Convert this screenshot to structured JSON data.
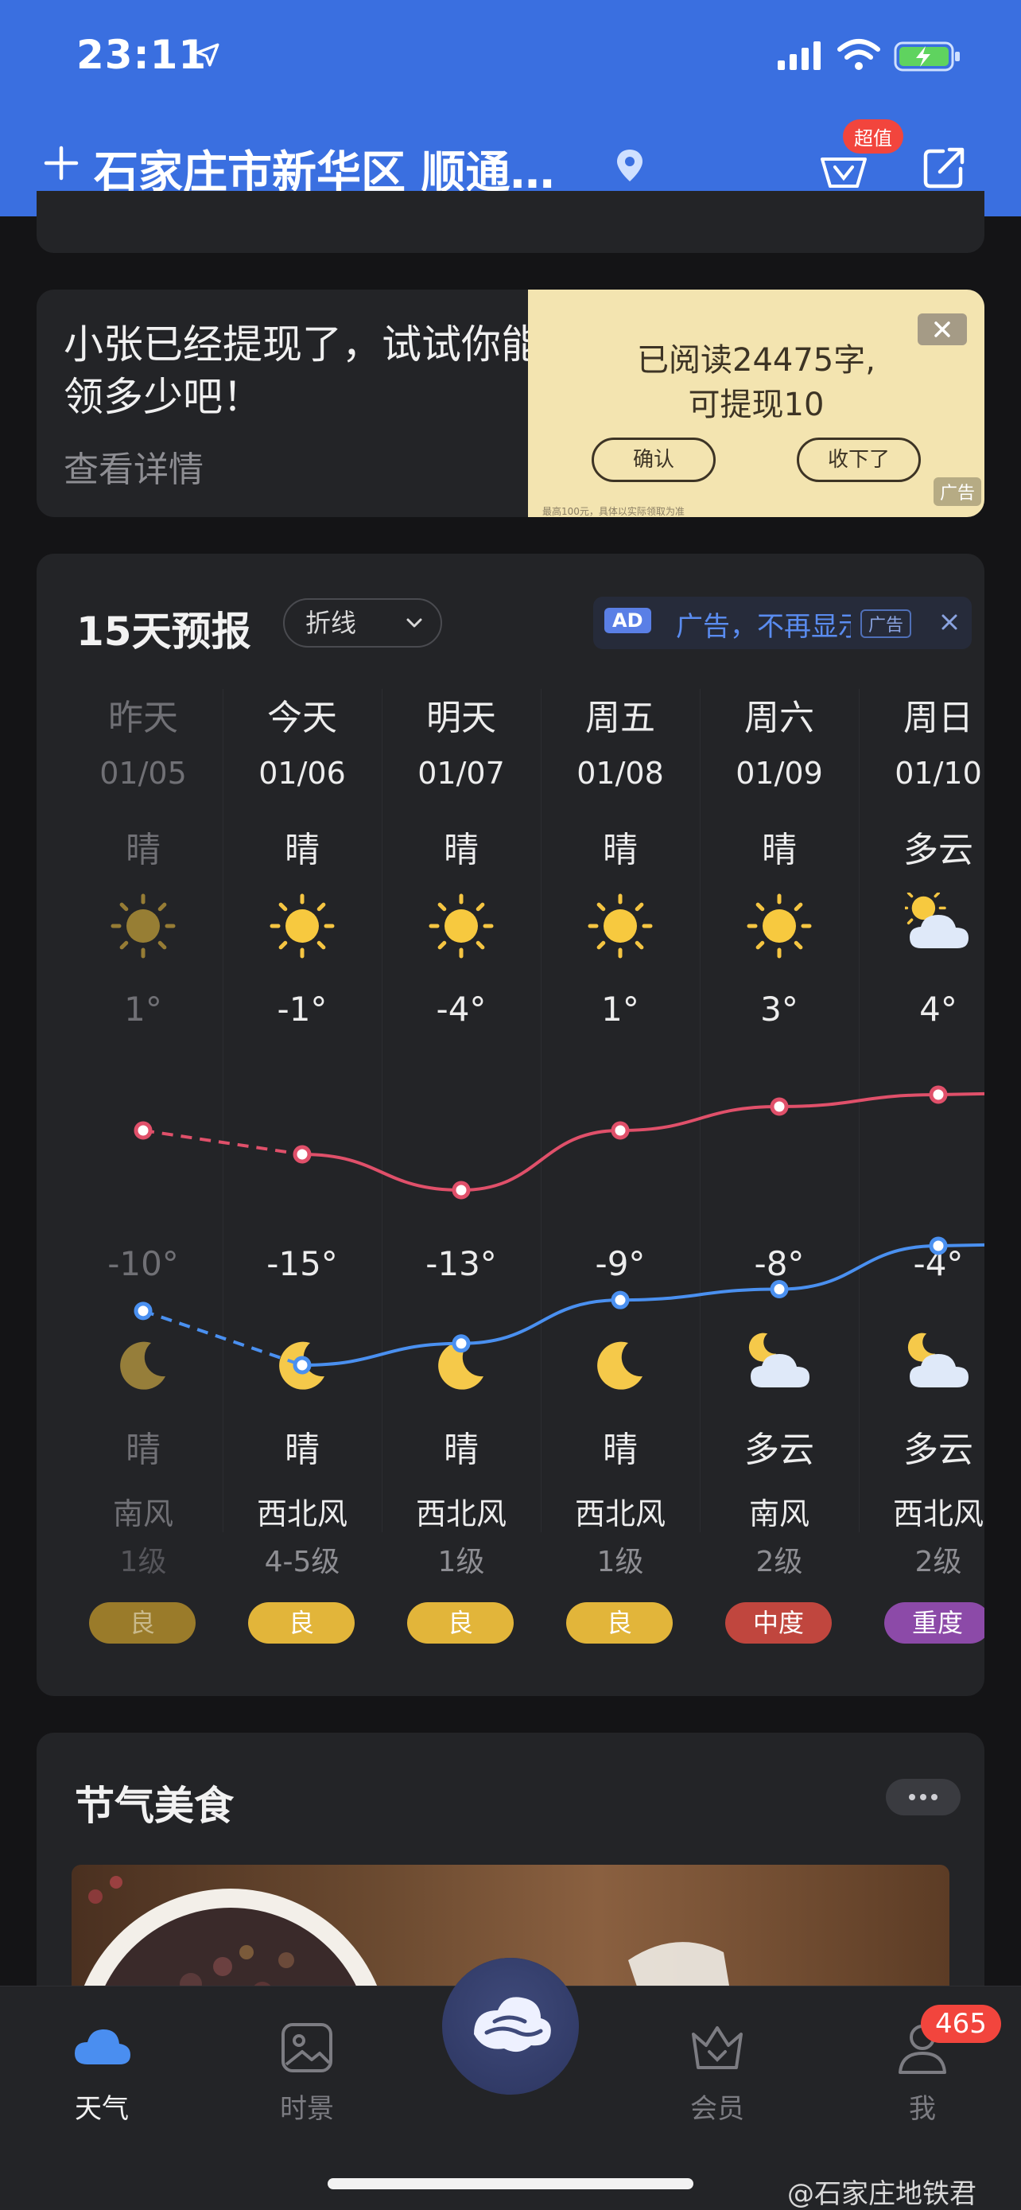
{
  "status_bar": {
    "time": "23:11"
  },
  "header": {
    "location": "石家庄市新华区 顺通…",
    "vip_badge": "超值"
  },
  "ad_card": {
    "title": "小张已经提现了，试试你能领多少吧！",
    "detail": "查看详情",
    "image_line1": "已阅读24475字,",
    "image_line2": "可提现10",
    "confirm_label": "确认",
    "dismiss_label": "收下了",
    "ad_tag": "广告",
    "fine_print": "最高100元，具体以实际领取为准"
  },
  "forecast": {
    "title": "15天预报",
    "mode": "折线",
    "ad_badge": "AD",
    "ad_text": "广告，不再显示",
    "ad_tag": "广告",
    "days": [
      {
        "name": "昨天",
        "date": "01/05",
        "day_cond": "晴",
        "day_icon": "sun-icon",
        "high": "1°",
        "low": "-10°",
        "night_icon": "moon-icon",
        "night_cond": "晴",
        "wind_dir": "南风",
        "wind_lvl": "1级",
        "aqi": "良",
        "aqi_color": "#9a7b2a",
        "past": true
      },
      {
        "name": "今天",
        "date": "01/06",
        "day_cond": "晴",
        "day_icon": "sun-icon",
        "high": "-1°",
        "low": "-15°",
        "night_icon": "moon-icon",
        "night_cond": "晴",
        "wind_dir": "西北风",
        "wind_lvl": "4-5级",
        "aqi": "良",
        "aqi_color": "#e2b53a",
        "past": false
      },
      {
        "name": "明天",
        "date": "01/07",
        "day_cond": "晴",
        "day_icon": "sun-icon",
        "high": "-4°",
        "low": "-13°",
        "night_icon": "moon-icon",
        "night_cond": "晴",
        "wind_dir": "西北风",
        "wind_lvl": "1级",
        "aqi": "良",
        "aqi_color": "#e2b53a",
        "past": false
      },
      {
        "name": "周五",
        "date": "01/08",
        "day_cond": "晴",
        "day_icon": "sun-icon",
        "high": "1°",
        "low": "-9°",
        "night_icon": "moon-icon",
        "night_cond": "晴",
        "wind_dir": "西北风",
        "wind_lvl": "1级",
        "aqi": "良",
        "aqi_color": "#e2b53a",
        "past": false
      },
      {
        "name": "周六",
        "date": "01/09",
        "day_cond": "晴",
        "day_icon": "sun-icon",
        "high": "3°",
        "low": "-8°",
        "night_icon": "cloud-moon-icon",
        "night_cond": "多云",
        "wind_dir": "南风",
        "wind_lvl": "2级",
        "aqi": "中度",
        "aqi_color": "#c0463e",
        "past": false
      },
      {
        "name": "周日",
        "date": "01/10",
        "day_cond": "多云",
        "day_icon": "cloud-sun-icon",
        "high": "4°",
        "low": "-4°",
        "night_icon": "cloud-moon-icon",
        "night_cond": "多云",
        "wind_dir": "西北风",
        "wind_lvl": "2级",
        "aqi": "重度",
        "aqi_color": "#8c4aa8",
        "past": false
      }
    ],
    "chart_data": {
      "type": "line",
      "categories": [
        "01/05",
        "01/06",
        "01/07",
        "01/08",
        "01/09",
        "01/10"
      ],
      "series": [
        {
          "values": [
            1,
            -1,
            -4,
            1,
            3,
            4
          ],
          "color": "#e0506a"
        },
        {
          "values": [
            -10,
            -15,
            -13,
            -9,
            -8,
            -4
          ],
          "color": "#4a90f0"
        }
      ]
    }
  },
  "food": {
    "title": "节气美食"
  },
  "tabbar": {
    "tabs": [
      {
        "label": "天气",
        "icon": "cloud-icon",
        "active": true
      },
      {
        "label": "时景",
        "icon": "photo-icon",
        "active": false
      },
      {
        "label": "会员",
        "icon": "crown-icon",
        "active": false
      },
      {
        "label": "我",
        "icon": "person-icon",
        "active": false
      }
    ],
    "center_icon": "app-logo-icon",
    "badge": "465"
  },
  "watermark": "@石家庄地铁君",
  "colors": {
    "header_blue": "#3a6fe0",
    "card_bg": "#232427",
    "page_bg": "#141416"
  }
}
